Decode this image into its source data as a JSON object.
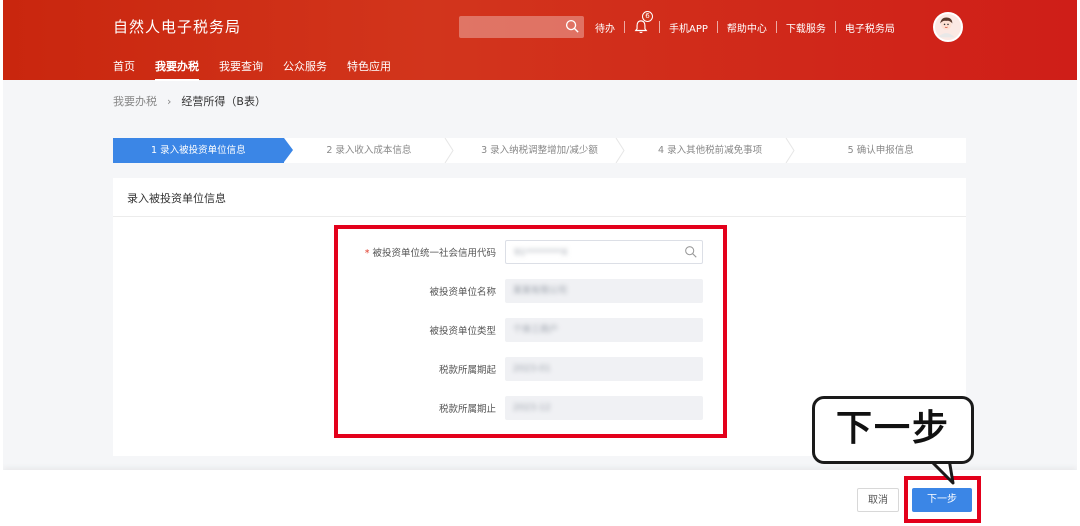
{
  "header": {
    "app_title": "自然人电子税务局",
    "search": {
      "placeholder": ""
    },
    "links": {
      "todo": "待办",
      "notification_count": "6",
      "mobile_app": "手机APP",
      "help_center": "帮助中心",
      "download_service": "下载服务",
      "e_tax_bureau": "电子税务局"
    },
    "nav": [
      {
        "label": "首页"
      },
      {
        "label": "我要办税"
      },
      {
        "label": "我要查询"
      },
      {
        "label": "公众服务"
      },
      {
        "label": "特色应用"
      }
    ]
  },
  "breadcrumb": {
    "parent": "我要办税",
    "current": "经营所得（B表）"
  },
  "steps": [
    {
      "label": "1  录入被投资单位信息",
      "active": true
    },
    {
      "label": "2  录入收入成本信息",
      "active": false
    },
    {
      "label": "3  录入纳税调整增加/减少额",
      "active": false
    },
    {
      "label": "4  录入其他税前减免事项",
      "active": false
    },
    {
      "label": "5  确认申报信息",
      "active": false
    }
  ],
  "card": {
    "title": "录入被投资单位信息",
    "required_mark": "*",
    "fields": [
      {
        "label": "被投资单位统一社会信用代码",
        "value": "91********X"
      },
      {
        "label": "被投资单位名称",
        "value": "某某有限公司"
      },
      {
        "label": "被投资单位类型",
        "value": "个体工商户"
      },
      {
        "label": "税款所属期起",
        "value": "2023-01"
      },
      {
        "label": "税款所属期止",
        "value": "2023-12"
      }
    ]
  },
  "footer": {
    "cancel_label": "取消",
    "next_label": "下一步"
  },
  "callout": {
    "text": "下一步"
  },
  "colors": {
    "header_red": "#d2351c",
    "primary_blue": "#3b86e6",
    "highlight_red": "#e3001b"
  }
}
